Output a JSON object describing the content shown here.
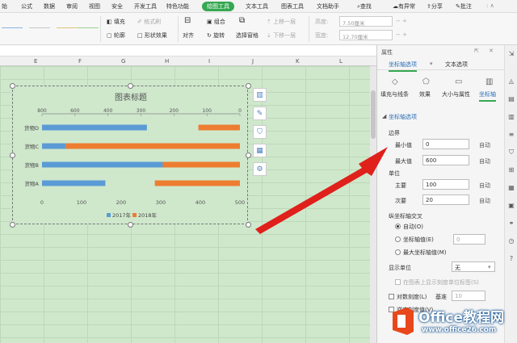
{
  "menubar": {
    "tabs": [
      "始",
      "公式",
      "数据",
      "审阅",
      "视图",
      "安全",
      "开发工具",
      "特色功能",
      "绘图工具",
      "文本工具",
      "图表工具",
      "文档助手",
      "查找"
    ],
    "active": "绘图工具",
    "right": [
      "有异常",
      "分享",
      "批注"
    ]
  },
  "ribbon": {
    "fill": "填充",
    "style": "格式刷",
    "outline": "轮廓",
    "shape_effect": "形状效果",
    "align": "对齐",
    "group": "组合",
    "rotate": "旋转",
    "selection_pane": "选择窗格",
    "bring_forward": "上移一层",
    "send_backward": "下移一层",
    "height_label": "高度:",
    "height_value": "7.50厘米",
    "width_label": "宽度:",
    "width_value": "12.70厘米"
  },
  "columns": [
    "E",
    "F",
    "G",
    "H",
    "I",
    "J",
    "K",
    "L"
  ],
  "chart_data": {
    "type": "bar",
    "title": "图表标题",
    "categories": [
      "货物A",
      "货物B",
      "货物C",
      "货物D"
    ],
    "series": [
      {
        "name": "2017年",
        "color": "#5b9bd5",
        "values": [
          160,
          310,
          60,
          265
        ]
      },
      {
        "name": "2018年",
        "color": "#ed7d31",
        "values": [
          215,
          195,
          440,
          105
        ]
      }
    ],
    "bottom_ticks": [
      "0",
      "100",
      "200",
      "300",
      "400",
      "500"
    ],
    "top_ticks": [
      "800",
      "600",
      "400",
      "300",
      "200",
      "100",
      "0"
    ],
    "xlim": [
      0,
      500
    ],
    "legend_position": "bottom"
  },
  "panel": {
    "title": "属性",
    "tab_axis": "坐标轴选项",
    "tab_text": "文本选项",
    "icon_fill": "填充与线条",
    "icon_effect": "效果",
    "icon_size": "大小与属性",
    "icon_axis": "坐标轴",
    "section": "坐标轴选项",
    "bounds": "边界",
    "min_label": "最小值",
    "min_value": "0",
    "max_label": "最大值",
    "max_value": "600",
    "auto": "自动",
    "units": "单位",
    "major_label": "主要",
    "major_value": "100",
    "minor_label": "次要",
    "minor_value": "20",
    "cross": "纵坐标轴交叉",
    "cross_auto": "自动(O)",
    "cross_value": "坐标轴值(E)",
    "cross_value_input": "0",
    "cross_max": "最大坐标轴值(M)",
    "display_units": "显示单位",
    "display_units_value": "无",
    "show_units_label": "在图表上显示刻度单位标签(S)",
    "log_scale": "对数刻度(L)",
    "base_label": "基准",
    "base_value": "10",
    "reverse": "逆序刻度值(V)"
  },
  "logo": {
    "line1": "Office教程网",
    "line2": "www.office26.com"
  }
}
